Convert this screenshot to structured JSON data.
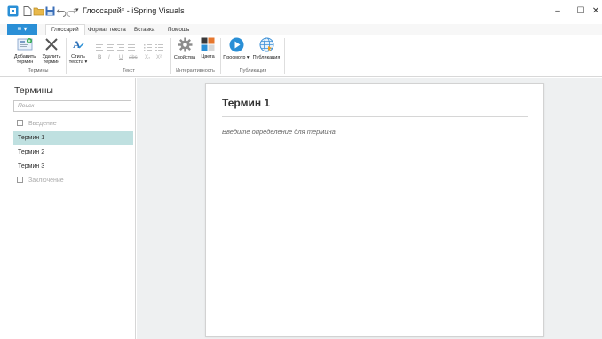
{
  "window": {
    "title": "Глоссарий* - iSpring Visuals",
    "controls": {
      "minimize": "–",
      "maximize": "☐",
      "close": "✕"
    }
  },
  "quick_access": [
    "app-icon",
    "new-icon",
    "open-icon",
    "save-icon",
    "undo-icon",
    "redo-icon",
    "customize-icon"
  ],
  "tabs": {
    "file": "≡ ▾",
    "items": [
      {
        "label": "Глоссарий",
        "active": true
      },
      {
        "label": "Формат текста",
        "active": false
      },
      {
        "label": "Вставка",
        "active": false
      },
      {
        "label": "Помощь",
        "active": false
      }
    ]
  },
  "ribbon": {
    "terms": {
      "add_label": "Добавить термин",
      "delete_label": "Удалить термин",
      "group_label": "Термины"
    },
    "text": {
      "style_label": "Стиль текста ▾",
      "format_buttons": [
        "B",
        "I",
        "U",
        "abc",
        "X₂",
        "X²"
      ],
      "group_label": "Текст"
    },
    "interactivity": {
      "properties_label": "Свойства",
      "colors_label": "Цвета",
      "group_label": "Интерактивность"
    },
    "publish": {
      "preview_label": "Просмотр ▾",
      "publish_label": "Публикация",
      "group_label": "Публикация"
    }
  },
  "sidebar": {
    "title": "Термины",
    "search_placeholder": "Поиск",
    "intro_label": "Введение",
    "terms": [
      {
        "label": "Термин 1",
        "selected": true
      },
      {
        "label": "Термин 2",
        "selected": false
      },
      {
        "label": "Термин 3",
        "selected": false
      }
    ],
    "outro_label": "Заключение"
  },
  "editor": {
    "term_title": "Термин 1",
    "definition_placeholder": "Введите определение для термина"
  },
  "colors": {
    "accent": "#2a8fd6",
    "selected_row": "#bfe0e0",
    "workspace_bg": "#eef0f1"
  }
}
